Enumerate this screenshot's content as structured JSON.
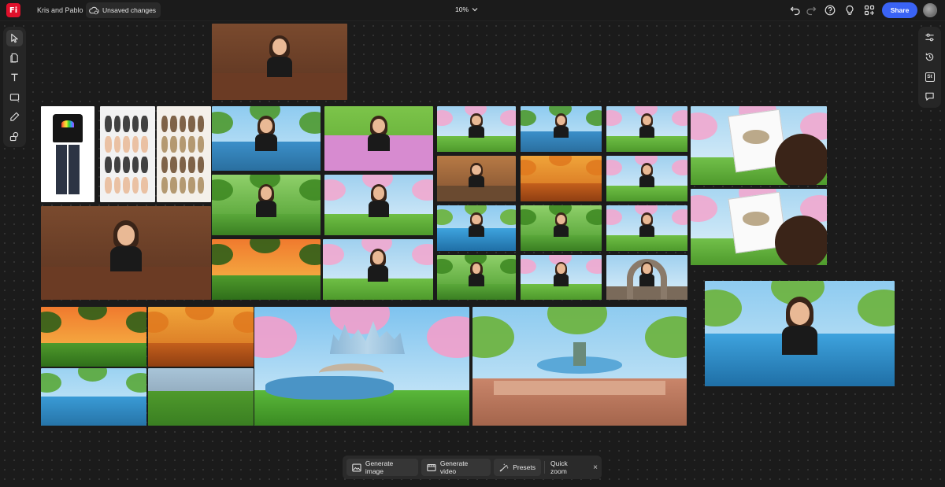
{
  "app": {
    "logo_text": "Fi",
    "project_name": "Kris and Pablo",
    "save_status": "Unsaved changes",
    "zoom_level": "10%",
    "share_label": "Share"
  },
  "header_icons": [
    "undo-icon",
    "redo-icon",
    "help-icon",
    "lightbulb-icon",
    "apps-icon"
  ],
  "left_tools": [
    "select-tool-icon",
    "page-tool-icon",
    "text-tool-icon",
    "rectangle-tool-icon",
    "pen-tool-icon",
    "shapes-tool-icon"
  ],
  "right_tools": [
    "adjust-icon",
    "history-icon",
    "stock-icon",
    "comment-icon"
  ],
  "right_tool_badge": "St",
  "bottom_bar": {
    "generate_image": "Generate image",
    "generate_video": "Generate video",
    "presets": "Presets",
    "quick_zoom": "Quick zoom",
    "close": "×"
  },
  "colors": {
    "accent": "#3a63f5",
    "brand": "#e0102b",
    "background": "#1b1b1b"
  }
}
